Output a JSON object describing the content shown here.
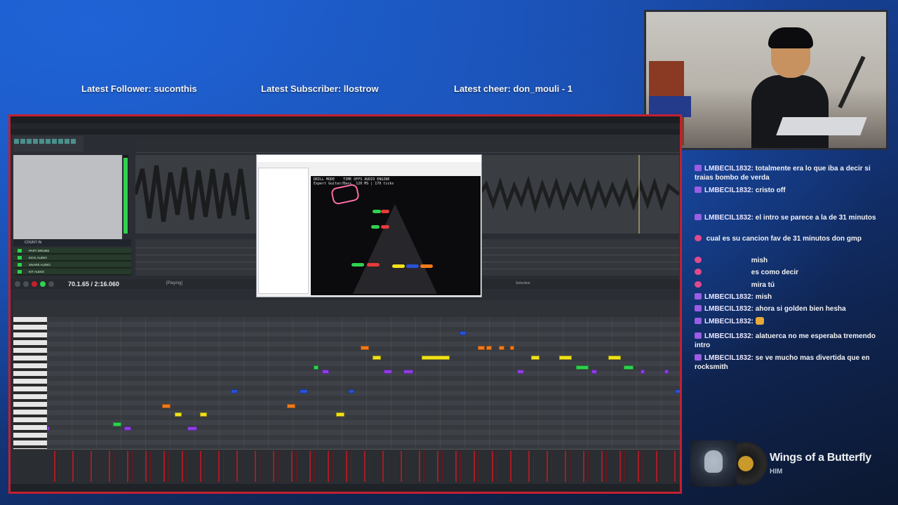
{
  "overlay": {
    "latest_follower": "Latest Follower: suconthis",
    "latest_subscriber": "Latest Subscriber: llostrow",
    "latest_cheer": "Latest cheer: don_mouli - 1"
  },
  "chat": {
    "messages": [
      {
        "user": "LMBECIL1832:",
        "text": "totalmente era lo que iba a decir si traias bombo de verda"
      },
      {
        "user": "LMBECIL1832:",
        "text": "cristo off"
      },
      {
        "user": "LMBECIL1832:",
        "text": "el intro se parece a la de 31 minutos"
      },
      {
        "user": "",
        "text": "cual es su cancion fav de 31 minutos don gmp"
      },
      {
        "user": "",
        "text": "mish"
      },
      {
        "user": "",
        "text": "es como decir"
      },
      {
        "user": "",
        "text": "mira tú"
      },
      {
        "user": "LMBECIL1832:",
        "text": "mish"
      },
      {
        "user": "LMBECIL1832:",
        "text": "ahora si golden bien hesha"
      },
      {
        "user": "LMBECIL1832:",
        "text": ""
      },
      {
        "user": "LMBECIL1832:",
        "text": "alatuerca no me esperaba tremendo intro"
      },
      {
        "user": "LMBECIL1832:",
        "text": "se ve mucho mas divertida que en rocksmith"
      }
    ]
  },
  "now_playing": {
    "title": "Wings of a Butterfly",
    "artist": "HIM"
  },
  "reaper": {
    "count_in": "COUNT IN",
    "tracks": [
      "PART DRUMS",
      "KICK AUDIO",
      "SNARE AUDIO",
      "KIT AUDIO"
    ],
    "time": "70.1.65 / 2:16.060",
    "status": "[Playing]",
    "selection_label": "Selection"
  },
  "clone_hero": {
    "stats_line1": "DRILL MODE    TIME OFFS AUDIO ENGINE",
    "stats_line2": "Expert Guitar/Bass  120 MS | 170 ticks"
  },
  "colors": {
    "accent_red": "#c42030",
    "chat_badge": "#9b5de5",
    "note_green": "#2fd14f",
    "note_red": "#e53a3a",
    "note_yellow": "#f0e21a",
    "note_blue": "#2a52d6",
    "note_orange": "#f07a1c",
    "note_purple": "#8e3ee0"
  }
}
